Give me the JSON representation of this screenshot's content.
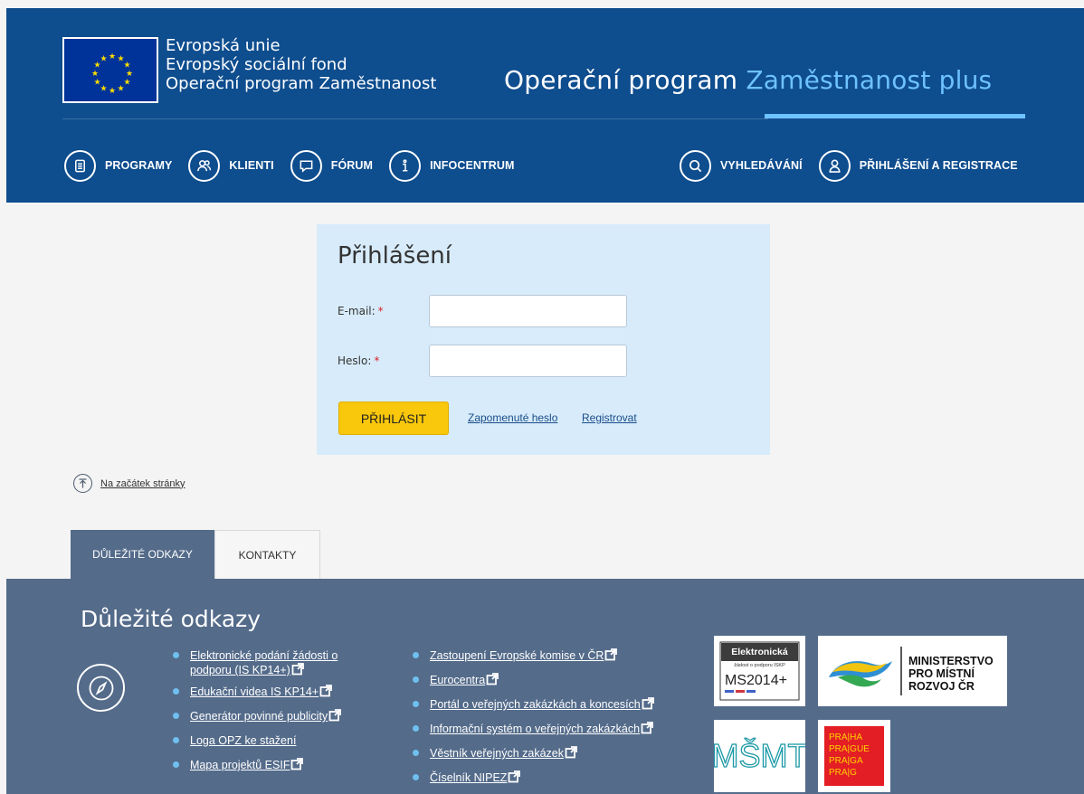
{
  "header": {
    "eu_lines": [
      "Evropská unie",
      "Evropský sociální fond",
      "Operační program Zaměstnanost"
    ],
    "title_part1": "Operační program",
    "title_part2": "Zaměstnanost plus",
    "nav_left": [
      {
        "label": "PROGRAMY",
        "icon": "list-icon"
      },
      {
        "label": "KLIENTI",
        "icon": "users-icon"
      },
      {
        "label": "FÓRUM",
        "icon": "chat-icon"
      },
      {
        "label": "INFOCENTRUM",
        "icon": "info-icon"
      }
    ],
    "nav_right": [
      {
        "label": "VYHLEDÁVÁNÍ",
        "icon": "search-icon"
      },
      {
        "label": "PŘIHLÁŠENÍ A REGISTRACE",
        "icon": "user-icon"
      }
    ]
  },
  "login": {
    "title": "Přihlášení",
    "email_label": "E-mail:",
    "password_label": "Heslo:",
    "required_mark": "*",
    "email_value": "",
    "password_value": "",
    "submit_label": "PŘIHLÁSIT",
    "forgot_label": "Zapomenuté heslo",
    "register_label": "Registrovat"
  },
  "back_to_top": "Na začátek stránky",
  "tabs": [
    {
      "label": "DŮLEŽITÉ ODKAZY",
      "active": true
    },
    {
      "label": "KONTAKTY",
      "active": false
    }
  ],
  "footer": {
    "title": "Důležité odkazy",
    "links_col1": [
      "Elektronické podání žádosti o podporu (IS KP14+)",
      "Edukační videa IS KP14+",
      "Generátor povinné publicity",
      "Loga OPZ ke stažení",
      "Mapa projektů ESIF"
    ],
    "links_col2": [
      "Zastoupení Evropské komise v ČR",
      "Eurocentra",
      "Portál o veřejných zakázkách a koncesích",
      "Informační systém o veřejných zakázkách",
      "Věstník veřejných zakázek",
      "Číselník NIPEZ"
    ],
    "logos": {
      "ms_line1": "Elektronická",
      "ms_line2": "žádost o podporu ISKP",
      "ms_line3": "MS2014+",
      "mmr_line1": "MINISTERSTVO",
      "mmr_line2": "PRO MÍSTNÍ",
      "mmr_line3": "ROZVOJ ČR",
      "msmt": "MŠMT",
      "praha_rows": [
        "PRA|HA",
        "PRA|GUE",
        "PRA|GA",
        "PRA|G"
      ]
    }
  },
  "colors": {
    "header_bg": "#0e4d8e",
    "accent_blue": "#6ec2ff",
    "login_bg": "#d7ebfa",
    "button_yellow": "#f9c70b",
    "footer_bg": "#546b8a",
    "bullet": "#6fc0ef"
  }
}
